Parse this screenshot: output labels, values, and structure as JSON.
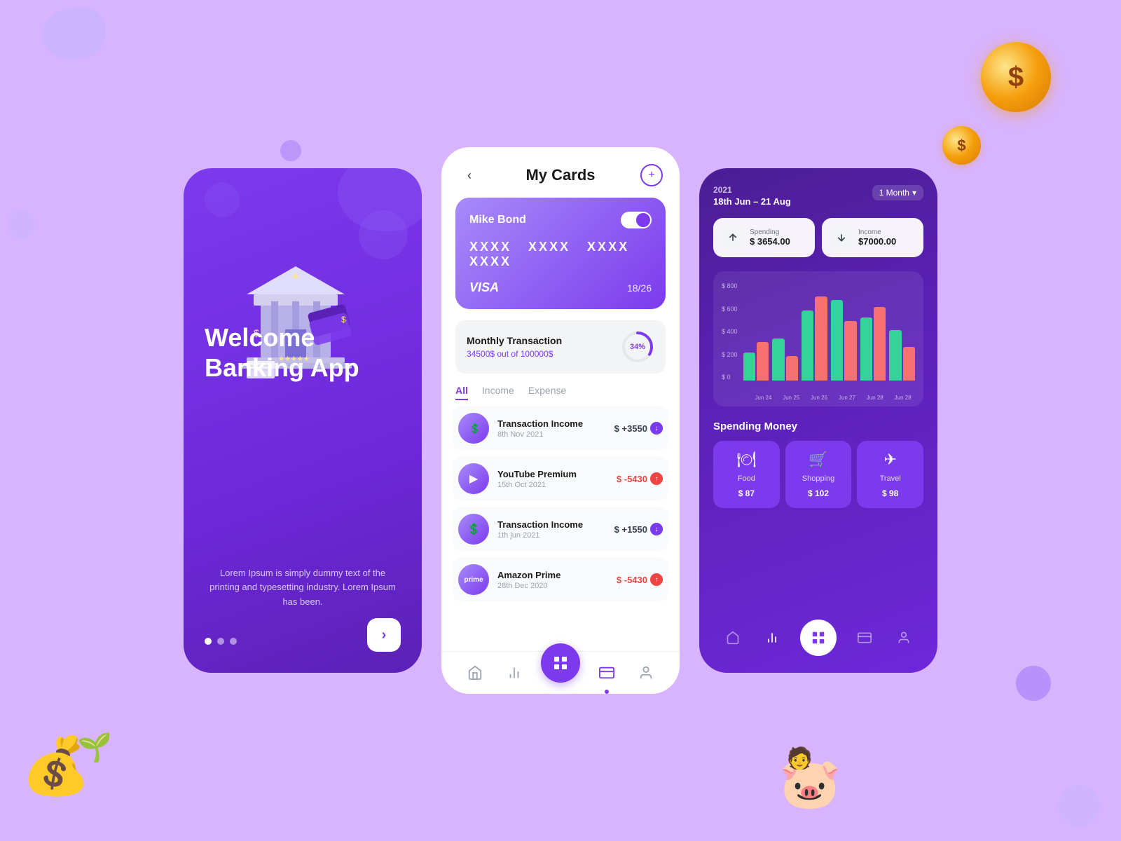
{
  "background": {
    "color": "#d8b4fe"
  },
  "panel1": {
    "title": "Welcome\nBanking App",
    "description": "Lorem Ipsum is simply dummy text of the printing and typesetting industry. Lorem Ipsum has been.",
    "dots": [
      "active",
      "inactive",
      "inactive"
    ],
    "next_label": "›"
  },
  "panel2": {
    "header": {
      "back_label": "‹",
      "title": "My Cards",
      "add_label": "+"
    },
    "card": {
      "holder": "Mike Bond",
      "number": "XXXX  XXXX  XXXX  XXXX",
      "brand": "VISA",
      "expiry": "18/26"
    },
    "monthly": {
      "title": "Monthly Transaction",
      "detail": "34500$ out of 100000$",
      "percent": "34%",
      "percent_num": 34
    },
    "tabs": [
      "All",
      "Income",
      "Expense"
    ],
    "active_tab": "All",
    "transactions": [
      {
        "id": 1,
        "icon": "💲",
        "name": "Transaction Income",
        "date": "8th Nov 2021",
        "amount": "$ +3550",
        "type": "positive",
        "arrow": "down"
      },
      {
        "id": 2,
        "icon": "▶",
        "name": "YouTube  Premium",
        "date": "15th Oct 2021",
        "amount": "$ -5430",
        "type": "negative",
        "arrow": "up"
      },
      {
        "id": 3,
        "icon": "💲",
        "name": "Transaction Income",
        "date": "1th jun 2021",
        "amount": "$ +1550",
        "type": "positive",
        "arrow": "down"
      },
      {
        "id": 4,
        "icon": "prime",
        "name": "Amazon Prime",
        "date": "28th Dec 2020",
        "amount": "$ -5430",
        "type": "negative",
        "arrow": "up"
      }
    ],
    "nav": {
      "items": [
        "home",
        "chart",
        "wallet",
        "user"
      ],
      "active": "wallet",
      "fab_icon": "⊞"
    }
  },
  "panel3": {
    "date_year": "2021",
    "date_range": "18th Jun – 21 Aug",
    "period_selector": "1 Month",
    "spending": {
      "label": "Spending",
      "amount": "$ 3654.00"
    },
    "income": {
      "label": "Income",
      "amount": "$7000.00"
    },
    "chart": {
      "y_labels": [
        "$ 800",
        "$ 600",
        "$ 400",
        "$ 200",
        "$ 0"
      ],
      "x_labels": [
        "Jun 24",
        "Jun 25",
        "Jun 26",
        "Jun 27",
        "Jun 28",
        "Jun 28"
      ],
      "bars": [
        {
          "green": 40,
          "red": 55
        },
        {
          "green": 60,
          "red": 35
        },
        {
          "green": 95,
          "red": 115
        },
        {
          "green": 110,
          "red": 80
        },
        {
          "green": 85,
          "red": 100
        },
        {
          "green": 70,
          "red": 45
        }
      ]
    },
    "spending_title": "Spending Money",
    "categories": [
      {
        "icon": "🍽",
        "label": "Food",
        "amount": "$ 87"
      },
      {
        "icon": "🛒",
        "label": "Shopping",
        "amount": "$ 102"
      },
      {
        "icon": "✈",
        "label": "Travel",
        "amount": "$ 98"
      }
    ],
    "nav": {
      "items": [
        "home",
        "chart",
        "grid",
        "wallet",
        "user"
      ],
      "active": "chart",
      "fab_icon": "⊞"
    }
  }
}
